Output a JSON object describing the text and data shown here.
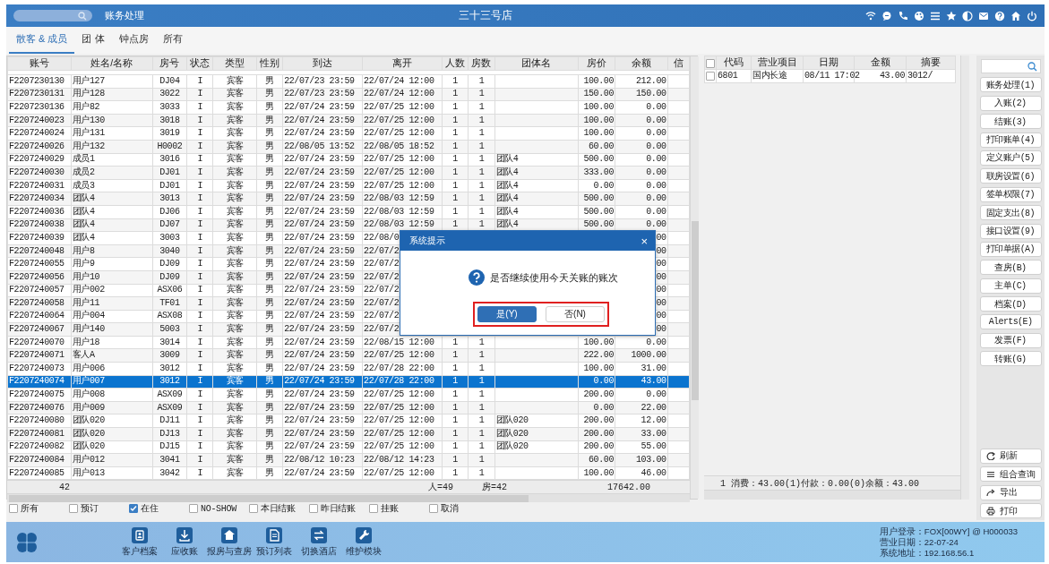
{
  "window": {
    "title": "三十三号店",
    "module": "账务处理"
  },
  "tabs": [
    {
      "label": "散客 & 成员",
      "selected": true
    },
    {
      "label": "团 体",
      "selected": false
    },
    {
      "label": "钟点房",
      "selected": false
    },
    {
      "label": "所有",
      "selected": false
    }
  ],
  "table": {
    "columns": [
      "账号",
      "姓名/名称",
      "房号",
      "状态",
      "类型",
      "性别",
      "到达",
      "离开",
      "人数",
      "房数",
      "团体名",
      "房价",
      "余额",
      "信"
    ],
    "rows": [
      {
        "account": "F2207230130",
        "name": "用户127",
        "room": "DJ04",
        "status": "I",
        "type": "宾客",
        "sex": "男",
        "arrive": "22/07/23 23:59",
        "depart": "22/07/24 12:00",
        "persons": "1",
        "rooms": "1",
        "price": "100.00",
        "balance": "212.00",
        "selected": false
      },
      {
        "account": "F2207230131",
        "name": "用户128",
        "room": "3022",
        "status": "I",
        "type": "宾客",
        "sex": "男",
        "arrive": "22/07/23 23:59",
        "depart": "22/07/24 12:00",
        "persons": "1",
        "rooms": "1",
        "price": "150.00",
        "balance": "150.00",
        "selected": false
      },
      {
        "account": "F2207230136",
        "name": "用户82",
        "room": "3033",
        "status": "I",
        "type": "宾客",
        "sex": "男",
        "arrive": "22/07/24 23:59",
        "depart": "22/07/25 12:00",
        "persons": "1",
        "rooms": "1",
        "price": "100.00",
        "balance": "0.00",
        "selected": false
      },
      {
        "account": "F2207240023",
        "name": "用户130",
        "room": "3018",
        "status": "I",
        "type": "宾客",
        "sex": "男",
        "arrive": "22/07/24 23:59",
        "depart": "22/07/25 12:00",
        "persons": "1",
        "rooms": "1",
        "price": "100.00",
        "balance": "0.00",
        "selected": false
      },
      {
        "account": "F2207240024",
        "name": "用户131",
        "room": "3019",
        "status": "I",
        "type": "宾客",
        "sex": "男",
        "arrive": "22/07/24 23:59",
        "depart": "22/07/25 12:00",
        "persons": "1",
        "rooms": "1",
        "price": "100.00",
        "balance": "0.00",
        "selected": false
      },
      {
        "account": "F2207240026",
        "name": "用户132",
        "room": "H0002",
        "status": "I",
        "type": "宾客",
        "sex": "男",
        "arrive": "22/08/05 13:52",
        "depart": "22/08/05 18:52",
        "persons": "1",
        "rooms": "1",
        "price": "60.00",
        "balance": "0.00",
        "selected": false
      },
      {
        "account": "F2207240029",
        "name": "成员1",
        "room": "3016",
        "status": "I",
        "type": "宾客",
        "sex": "男",
        "arrive": "22/07/24 23:59",
        "depart": "22/07/25 12:00",
        "persons": "1",
        "rooms": "1",
        "group": "团队4",
        "price": "500.00",
        "balance": "0.00",
        "selected": false
      },
      {
        "account": "F2207240030",
        "name": "成员2",
        "room": "DJ01",
        "status": "I",
        "type": "宾客",
        "sex": "男",
        "arrive": "22/07/24 23:59",
        "depart": "22/07/25 12:00",
        "persons": "1",
        "rooms": "1",
        "group": "团队4",
        "price": "333.00",
        "balance": "0.00",
        "selected": false
      },
      {
        "account": "F2207240031",
        "name": "成员3",
        "room": "DJ01",
        "status": "I",
        "type": "宾客",
        "sex": "男",
        "arrive": "22/07/24 23:59",
        "depart": "22/07/25 12:00",
        "persons": "1",
        "rooms": "1",
        "group": "团队4",
        "price": "0.00",
        "balance": "0.00",
        "selected": false
      },
      {
        "account": "F2207240034",
        "name": "团队4",
        "room": "3013",
        "status": "I",
        "type": "宾客",
        "sex": "男",
        "arrive": "22/07/24 23:59",
        "depart": "22/08/03 12:59",
        "persons": "1",
        "rooms": "1",
        "group": "团队4",
        "price": "500.00",
        "balance": "0.00",
        "selected": false
      },
      {
        "account": "F2207240036",
        "name": "团队4",
        "room": "DJ06",
        "status": "I",
        "type": "宾客",
        "sex": "男",
        "arrive": "22/07/24 23:59",
        "depart": "22/08/03 12:59",
        "persons": "1",
        "rooms": "1",
        "group": "团队4",
        "price": "500.00",
        "balance": "0.00",
        "selected": false
      },
      {
        "account": "F2207240038",
        "name": "团队4",
        "room": "DJ07",
        "status": "I",
        "type": "宾客",
        "sex": "男",
        "arrive": "22/07/24 23:59",
        "depart": "22/08/03 12:59",
        "persons": "1",
        "rooms": "1",
        "group": "团队4",
        "price": "500.00",
        "balance": "0.00",
        "selected": false
      },
      {
        "account": "F2207240039",
        "name": "团队4",
        "room": "3003",
        "status": "I",
        "type": "宾客",
        "sex": "男",
        "arrive": "22/07/24 23:59",
        "depart": "22/08/0",
        "balance": "00",
        "selected": false
      },
      {
        "account": "F2207240048",
        "name": "用户8",
        "room": "3040",
        "status": "I",
        "type": "宾客",
        "sex": "男",
        "arrive": "22/07/24 23:59",
        "depart": "22/07/2",
        "balance": "00",
        "selected": false
      },
      {
        "account": "F2207240055",
        "name": "用户9",
        "room": "DJ09",
        "status": "I",
        "type": "宾客",
        "sex": "男",
        "arrive": "22/07/24 23:59",
        "depart": "22/07/2",
        "balance": "00",
        "selected": false
      },
      {
        "account": "F2207240056",
        "name": "用户10",
        "room": "DJ09",
        "status": "I",
        "type": "宾客",
        "sex": "男",
        "arrive": "22/07/24 23:59",
        "depart": "22/07/2",
        "balance": "00",
        "selected": false
      },
      {
        "account": "F2207240057",
        "name": "用户002",
        "room": "ASX06",
        "status": "I",
        "type": "宾客",
        "sex": "男",
        "arrive": "22/07/24 23:59",
        "depart": "22/07/2",
        "balance": "00",
        "selected": false
      },
      {
        "account": "F2207240058",
        "name": "用户11",
        "room": "TF01",
        "status": "I",
        "type": "宾客",
        "sex": "男",
        "arrive": "22/07/24 23:59",
        "depart": "22/07/2",
        "balance": "00",
        "selected": false
      },
      {
        "account": "F2207240064",
        "name": "用户004",
        "room": "ASX08",
        "status": "I",
        "type": "宾客",
        "sex": "男",
        "arrive": "22/07/24 23:59",
        "depart": "22/07/2",
        "balance": "00",
        "selected": false
      },
      {
        "account": "F2207240067",
        "name": "用户140",
        "room": "5003",
        "status": "I",
        "type": "宾客",
        "sex": "男",
        "arrive": "22/07/24 23:59",
        "depart": "22/07/2",
        "balance": "00",
        "selected": false
      },
      {
        "account": "F2207240070",
        "name": "用户18",
        "room": "3014",
        "status": "I",
        "type": "宾客",
        "sex": "男",
        "arrive": "22/07/24 23:59",
        "depart": "22/08/15 12:00",
        "persons": "1",
        "rooms": "1",
        "price": "100.00",
        "balance": "0.00",
        "selected": false
      },
      {
        "account": "F2207240071",
        "name": "客人A",
        "room": "3009",
        "status": "I",
        "type": "宾客",
        "sex": "男",
        "arrive": "22/07/24 23:59",
        "depart": "22/07/25 12:00",
        "persons": "1",
        "rooms": "1",
        "price": "222.00",
        "balance": "1000.00",
        "selected": false
      },
      {
        "account": "F2207240073",
        "name": "用户006",
        "room": "3012",
        "status": "I",
        "type": "宾客",
        "sex": "男",
        "arrive": "22/07/24 23:59",
        "depart": "22/07/28 22:00",
        "persons": "1",
        "rooms": "1",
        "price": "100.00",
        "balance": "31.00",
        "selected": false
      },
      {
        "account": "F2207240074",
        "name": "用户007",
        "room": "3012",
        "status": "I",
        "type": "宾客",
        "sex": "男",
        "arrive": "22/07/24 23:59",
        "depart": "22/07/28 22:00",
        "persons": "1",
        "rooms": "1",
        "price": "0.00",
        "balance": "43.00",
        "selected": true
      },
      {
        "account": "F2207240075",
        "name": "用户008",
        "room": "ASX09",
        "status": "I",
        "type": "宾客",
        "sex": "男",
        "arrive": "22/07/24 23:59",
        "depart": "22/07/25 12:00",
        "persons": "1",
        "rooms": "1",
        "price": "200.00",
        "balance": "0.00",
        "selected": false
      },
      {
        "account": "F2207240076",
        "name": "用户009",
        "room": "ASX09",
        "status": "I",
        "type": "宾客",
        "sex": "男",
        "arrive": "22/07/24 23:59",
        "depart": "22/07/25 12:00",
        "persons": "1",
        "rooms": "1",
        "price": "0.00",
        "balance": "22.00",
        "selected": false
      },
      {
        "account": "F2207240080",
        "name": "团队020",
        "room": "DJ11",
        "status": "I",
        "type": "宾客",
        "sex": "男",
        "arrive": "22/07/24 23:59",
        "depart": "22/07/25 12:00",
        "persons": "1",
        "rooms": "1",
        "group": "团队020",
        "price": "200.00",
        "balance": "12.00",
        "selected": false
      },
      {
        "account": "F2207240081",
        "name": "团队020",
        "room": "DJ13",
        "status": "I",
        "type": "宾客",
        "sex": "男",
        "arrive": "22/07/24 23:59",
        "depart": "22/07/25 12:00",
        "persons": "1",
        "rooms": "1",
        "group": "团队020",
        "price": "200.00",
        "balance": "33.00",
        "selected": false
      },
      {
        "account": "F2207240082",
        "name": "团队020",
        "room": "DJ15",
        "status": "I",
        "type": "宾客",
        "sex": "男",
        "arrive": "22/07/24 23:59",
        "depart": "22/07/25 12:00",
        "persons": "1",
        "rooms": "1",
        "group": "团队020",
        "price": "200.00",
        "balance": "55.00",
        "selected": false
      },
      {
        "account": "F2207240084",
        "name": "用户012",
        "room": "3041",
        "status": "I",
        "type": "宾客",
        "sex": "男",
        "arrive": "22/08/12 10:23",
        "depart": "22/08/12 14:23",
        "persons": "1",
        "rooms": "1",
        "price": "60.00",
        "balance": "103.00",
        "selected": false
      },
      {
        "account": "F2207240085",
        "name": "用户013",
        "room": "3042",
        "status": "I",
        "type": "宾客",
        "sex": "男",
        "arrive": "22/07/24 23:59",
        "depart": "22/07/25 12:00",
        "persons": "1",
        "rooms": "1",
        "price": "100.00",
        "balance": "46.00",
        "selected": false
      }
    ],
    "footer": {
      "count": "42",
      "persons": "人=49",
      "rooms": "房=42",
      "balance": "17642.00"
    }
  },
  "detail_table": {
    "all_checked": false,
    "columns": [
      "代码",
      "营业项目",
      "日期",
      "金额",
      "摘要"
    ],
    "rows": [
      {
        "checked": false,
        "code": "6801",
        "item": "国内长途",
        "date": "08/11 17:02",
        "amount": "43.00",
        "memo": "3012/"
      }
    ],
    "summary": "1 消费：43.00(1)付款：0.00(0)余额：43.00"
  },
  "filters": [
    {
      "label": "所有",
      "checked": false
    },
    {
      "label": "预订",
      "checked": false
    },
    {
      "label": "在住",
      "checked": true
    },
    {
      "label": "NO-SHOW",
      "checked": false
    },
    {
      "label": "本日结账",
      "checked": false
    },
    {
      "label": "昨日结账",
      "checked": false
    },
    {
      "label": "挂账",
      "checked": false
    },
    {
      "label": "取消",
      "checked": false
    }
  ],
  "sidebar": {
    "actions": [
      "账务处理(1)",
      "入账(2)",
      "结账(3)",
      "打印账单(4)",
      "定义账户(5)",
      "联房设置(6)",
      "签单权限(7)",
      "固定支出(8)",
      "接口设置(9)",
      "打印单据(A)",
      "查房(B)",
      "主单(C)",
      "档案(D)",
      "Alerts(E)",
      "发票(F)",
      "转账(G)"
    ],
    "tools": [
      "刷新",
      "组合查询",
      "导出",
      "打印"
    ]
  },
  "dock": [
    "客户档案",
    "应收账",
    "报房与查房",
    "预订列表",
    "切换酒店",
    "维护模块"
  ],
  "status": [
    "用户登录：FOX[00WY] @ H000033",
    "营业日期：22-07-24",
    "系统地址：192.168.56.1"
  ],
  "dialog": {
    "title": "系统提示",
    "close": "×",
    "message": "是否继续使用今天关账的账次",
    "buttons": [
      {
        "label": "是(Y)",
        "kind": "primary"
      },
      {
        "label": "否(N)",
        "kind": "secondary"
      }
    ]
  }
}
